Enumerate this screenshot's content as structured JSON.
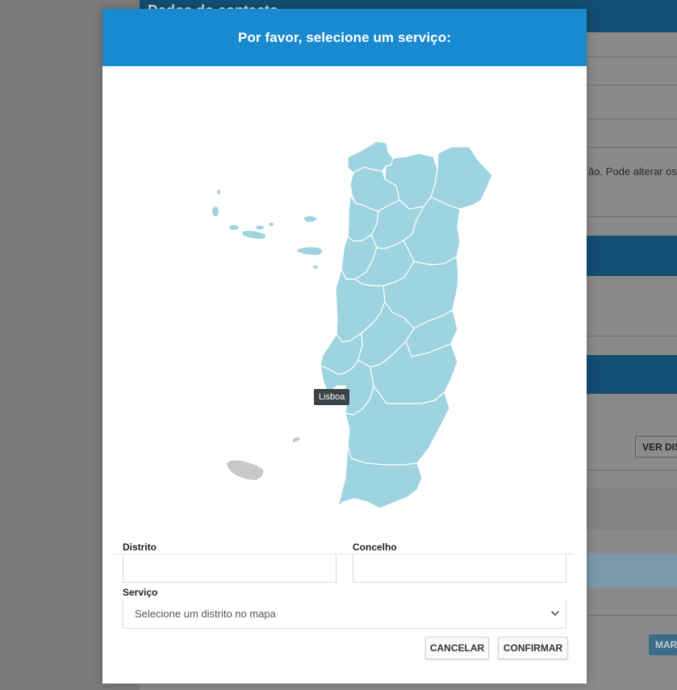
{
  "background": {
    "title": "Dados do contacto",
    "notice_text": "ão. Pode alterar os c",
    "button_label": "VER DISTRITOS",
    "button2_label": "MARCAR"
  },
  "modal": {
    "title": "Por favor, selecione um serviço:",
    "map": {
      "tooltip": "Lisboa",
      "highlight_color": "#9dd4df",
      "inactive_color": "#c8c8c8"
    },
    "form": {
      "district_label": "Distrito",
      "district_value": "",
      "municipality_label": "Concelho",
      "municipality_value": "",
      "service_label": "Serviço",
      "service_selected": "Selecione um distrito no mapa"
    },
    "buttons": {
      "cancel": "CANCELAR",
      "confirm": "CONFIRMAR"
    }
  },
  "colors": {
    "header": "#1a8ad0",
    "background_overlay": "#7b7b7b"
  }
}
